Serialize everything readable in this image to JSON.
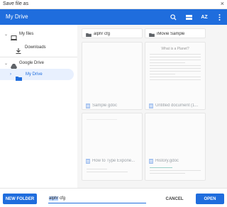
{
  "window": {
    "title": "Save file as",
    "close_glyph": "×"
  },
  "appbar": {
    "title": "My Drive",
    "icons": [
      "search-icon",
      "grid-view-icon",
      "sort-icon",
      "more-vert-icon"
    ],
    "sort_label": "AZ"
  },
  "sidebar": {
    "items": [
      {
        "label": "My files",
        "icon": "laptop-icon",
        "expanded": true
      },
      {
        "label": "Downloads",
        "icon": "download-icon"
      },
      {
        "label": "Google Drive",
        "icon": "drive-icon",
        "expanded": true
      },
      {
        "label": "My Drive",
        "icon": "folder-icon",
        "selected": true
      }
    ]
  },
  "files": [
    {
      "name": "alphr cfg",
      "type": "folder",
      "enabled": true
    },
    {
      "name": "iMovie Sample",
      "type": "folder",
      "enabled": true
    },
    {
      "name": "Sample gdoc",
      "type": "gdoc",
      "enabled": false
    },
    {
      "name": "Untitled document (1...",
      "type": "gdoc",
      "enabled": false,
      "preview_title": "What is a Planet?"
    },
    {
      "name": "How to Type Expone...",
      "type": "gdoc",
      "enabled": false
    },
    {
      "name": "History.gdoc",
      "type": "gdoc",
      "enabled": false
    }
  ],
  "bottom": {
    "new_folder": "NEW FOLDER",
    "filename_value": "alphr cfg",
    "filename_selected": "alphr",
    "filename_rest": " cfg",
    "cancel": "CANCEL",
    "open": "OPEN"
  },
  "colors": {
    "accent": "#1f6ddd",
    "selected_bg": "#e8f0fe"
  }
}
